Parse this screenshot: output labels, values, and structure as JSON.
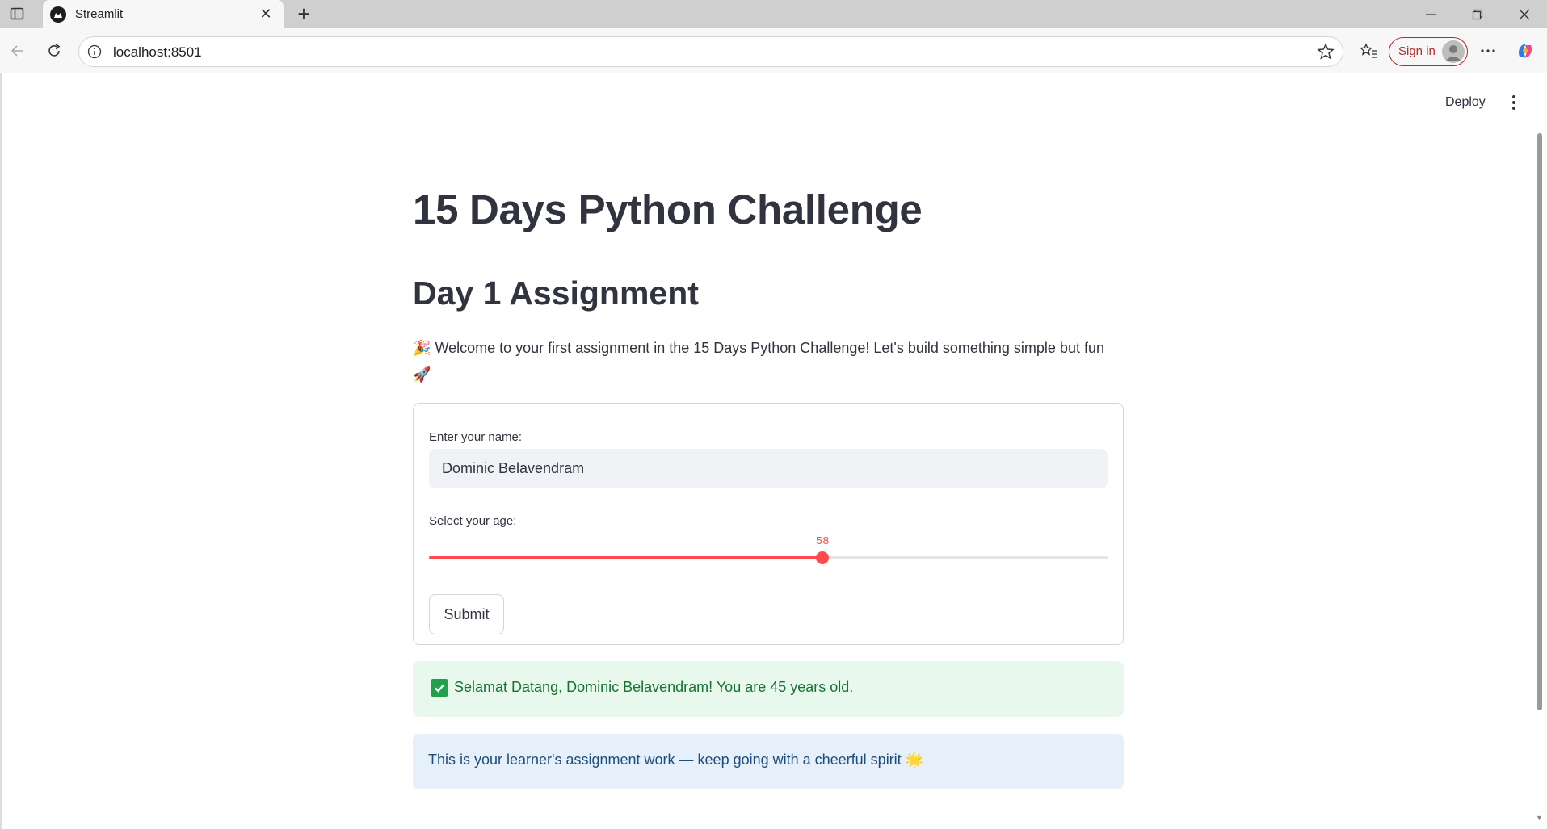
{
  "browser": {
    "tab_title": "Streamlit",
    "url": "localhost:8501",
    "signin_label": "Sign in",
    "new_tab_symbol": "+",
    "close_tab_symbol": "✕"
  },
  "app": {
    "deploy_label": "Deploy",
    "title": "15 Days Python Challenge",
    "subtitle": "Day 1 Assignment",
    "intro_emoji": "🎉",
    "intro_text": "Welcome to your first assignment in the 15 Days Python Challenge! Let's build something simple but fun",
    "intro_end_emoji": "🚀",
    "form": {
      "name_label": "Enter your name:",
      "name_value": "Dominic Belavendram",
      "age_label": "Select your age:",
      "age_value": "58",
      "age_min": 0,
      "age_max": 100,
      "submit_label": "Submit"
    },
    "success_message": "Selamat Datang, Dominic Belavendram! You are 45 years old.",
    "info_message": "This is your learner's assignment work — keep going with a cheerful spirit",
    "info_emoji": "🌟"
  },
  "colors": {
    "accent": "#ff4b4b",
    "success_bg": "#e8f8ed",
    "info_bg": "#e6f0fb",
    "text": "#31333f"
  }
}
